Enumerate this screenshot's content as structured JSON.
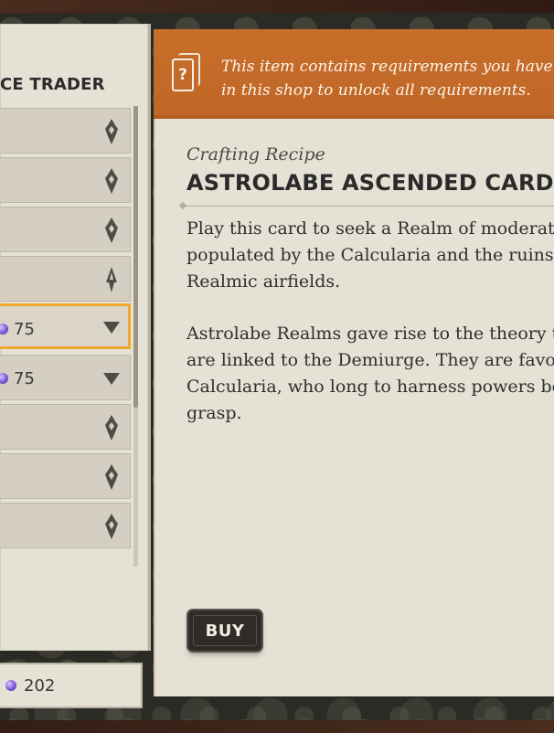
{
  "shop": {
    "title": "CE TRADER",
    "list": [
      {
        "icon": "shield-icon",
        "price": null,
        "selected": false
      },
      {
        "icon": "shield-icon",
        "price": null,
        "selected": false
      },
      {
        "icon": "shield-icon",
        "price": null,
        "selected": false
      },
      {
        "icon": "feather-icon",
        "price": null,
        "selected": false
      },
      {
        "icon": "chevron-down-icon",
        "price": "75",
        "selected": true
      },
      {
        "icon": "chevron-down-icon",
        "price": "75",
        "selected": false
      },
      {
        "icon": "shield-icon",
        "price": null,
        "selected": false
      },
      {
        "icon": "shield-icon",
        "price": null,
        "selected": false
      },
      {
        "icon": "shield-icon",
        "price": null,
        "selected": false
      }
    ],
    "balance": "202"
  },
  "notice": {
    "line1": "This item contains requirements you have",
    "line2": "in this shop to unlock all requirements."
  },
  "detail": {
    "subtitle": "Crafting Recipe",
    "title": "ASTROLABE ASCENDED CARD",
    "para1_line1": "Play this card to seek a Realm of moderate",
    "para1_line2": "populated by the Calcularia and the ruins",
    "para1_line3": "Realmic airfields.",
    "para2_line1": "Astrolabe Realms gave rise to the theory t",
    "para2_line2": "are linked to the Demiurge. They are favo",
    "para2_line3": "Calcularia, who long to harness powers be",
    "para2_line4": "grasp."
  },
  "actions": {
    "buy_label": "BUY"
  },
  "colors": {
    "notice_orange": "#c86f2b",
    "selection_outline": "#f0a92c",
    "panel_paper": "#e6e1d5",
    "button_dark": "#2f2b27",
    "gem_purple": "#7d57d8"
  }
}
